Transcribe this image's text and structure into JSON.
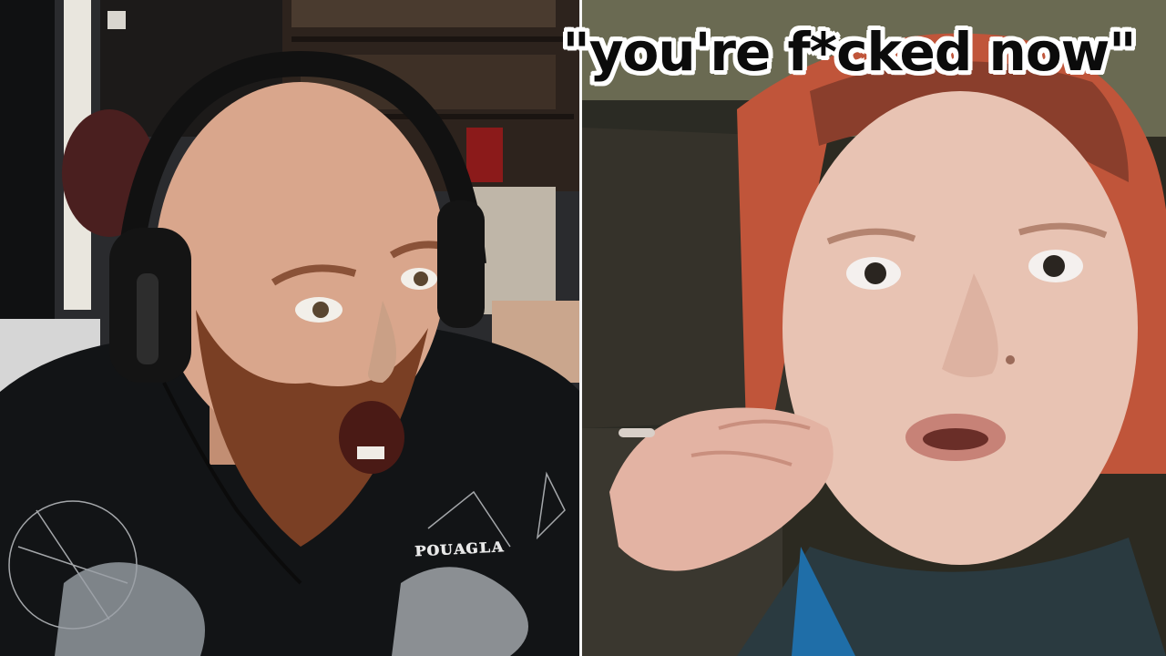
{
  "caption": {
    "text": "\"you're f*cked now\"",
    "color": "#0b0b0b",
    "outline_color": "#ffffff"
  },
  "left_panel": {
    "subject": "bald-man-with-headset-reacting",
    "hoodie_text": "ᴘᴏᴜᴀɢʟᴀ"
  },
  "right_panel": {
    "subject": "woman-with-red-hair-gesturing"
  },
  "colors": {
    "divider": "#f4f4f4",
    "skin_left": "#d9a68c",
    "beard": "#7a3f24",
    "hoodie": "#121416",
    "hair_right": "#c0553a",
    "skin_right": "#e8c3b3",
    "bg_right": "#2c2a21"
  }
}
